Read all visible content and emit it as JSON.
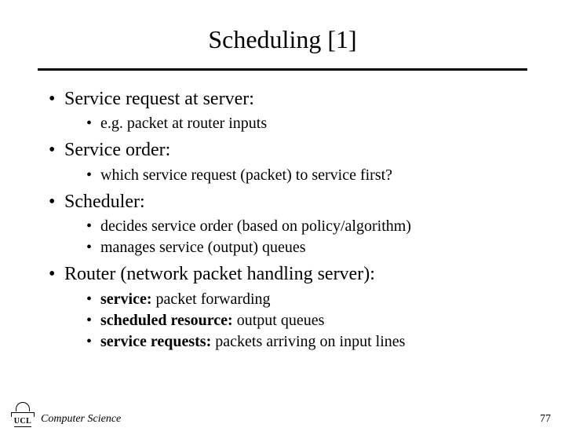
{
  "title": "Scheduling [1]",
  "bullets": {
    "b1": "Service request at server:",
    "b1_1": "e.g. packet at router inputs",
    "b2": "Service order:",
    "b2_1": "which service request (packet) to service first?",
    "b3": "Scheduler:",
    "b3_1": "decides service order (based on policy/algorithm)",
    "b3_2": "manages service (output) queues",
    "b4": "Router (network packet handling server):",
    "b4_1_bold": "service:",
    "b4_1_rest": " packet forwarding",
    "b4_2_bold": "scheduled resource:",
    "b4_2_rest": " output queues",
    "b4_3_bold": "service requests:",
    "b4_3_rest": " packets arriving on input lines"
  },
  "footer": {
    "logo_text": "UCL",
    "dept": "Computer Science",
    "page": "77"
  }
}
